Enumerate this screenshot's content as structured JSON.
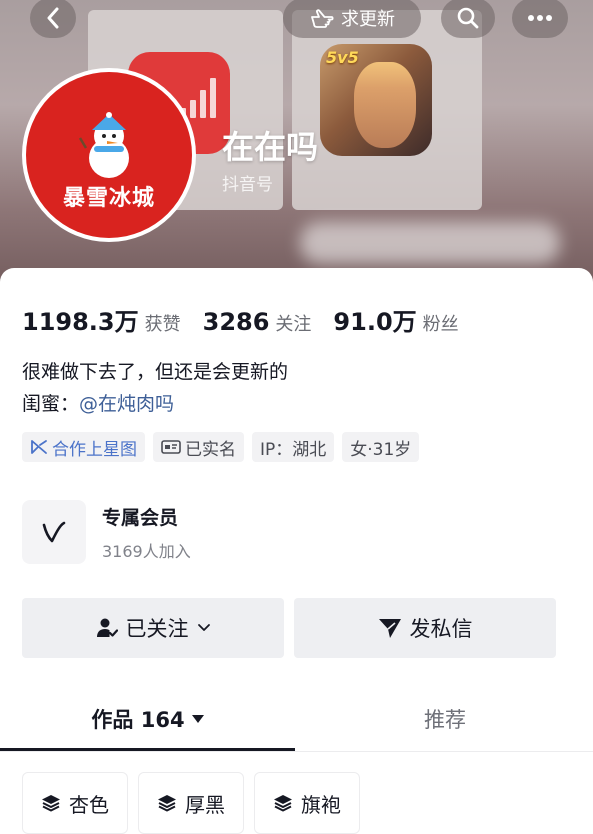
{
  "header": {
    "update_label": "求更新"
  },
  "cover": {
    "game_badge": "5v5"
  },
  "profile": {
    "avatar_text": "暴雪冰城",
    "nickname": "在在吗",
    "id_label": "抖音号"
  },
  "stats": [
    {
      "value": "1198.3万",
      "label": "获赞"
    },
    {
      "value": "3286",
      "label": "关注"
    },
    {
      "value": "91.0万",
      "label": "粉丝"
    }
  ],
  "bio": {
    "line1": "很难做下去了，但还是会更新的",
    "line2_prefix": "闺蜜：",
    "line2_mention": "@在炖肉吗"
  },
  "tags": [
    {
      "label": "合作上星图",
      "icon": "star-map-icon"
    },
    {
      "label": "已实名",
      "icon": "id-card-icon"
    },
    {
      "label": "IP：湖北",
      "icon": ""
    },
    {
      "label": "女·31岁",
      "icon": ""
    }
  ],
  "member": {
    "title": "专属会员",
    "count": "3169人加入"
  },
  "actions": {
    "follow_label": "已关注",
    "message_label": "发私信"
  },
  "tabs": {
    "works_label": "作品 164",
    "recommend_label": "推荐"
  },
  "collections": [
    {
      "label": "杏色"
    },
    {
      "label": "厚黑"
    },
    {
      "label": "旗袍"
    }
  ],
  "colors": {
    "mention": "#3e5f97",
    "star_tag": "#4b73c9",
    "avatar_red": "#d9231f"
  }
}
